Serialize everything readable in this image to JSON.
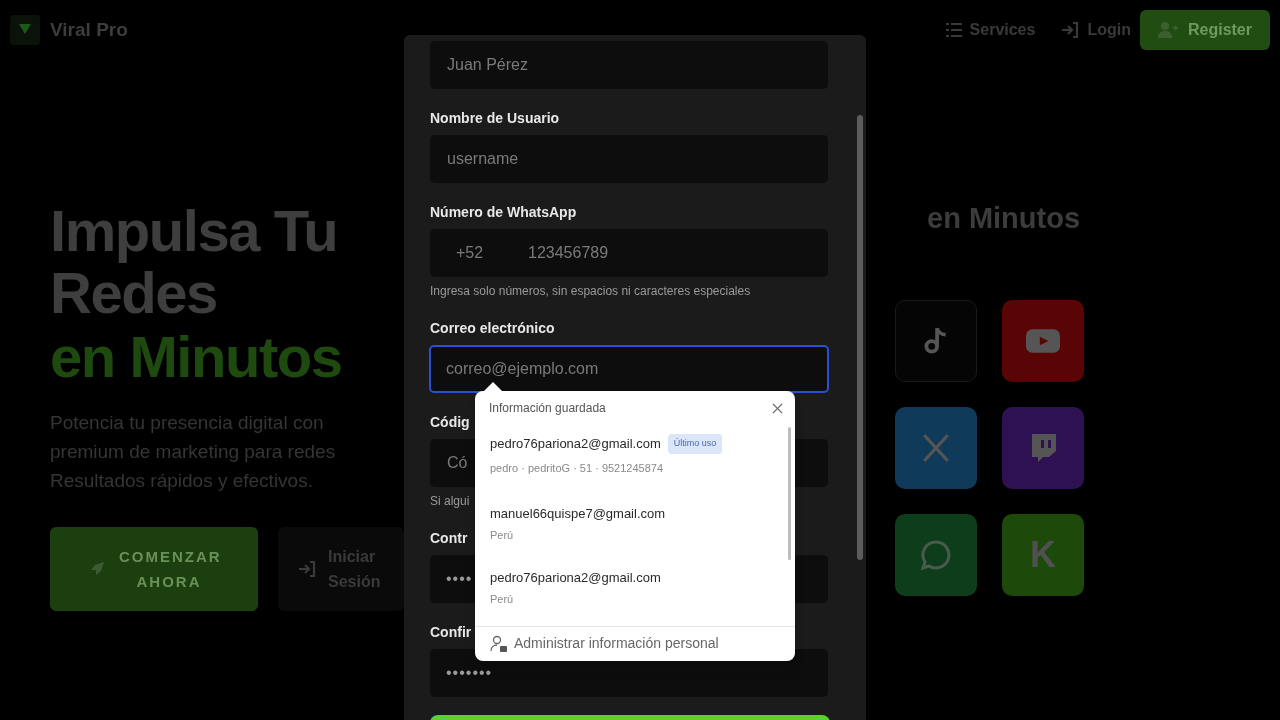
{
  "header": {
    "brand": "Viral Pro",
    "nav": [
      {
        "kind": "list",
        "label": "Services"
      },
      {
        "kind": "login",
        "label": "Login"
      }
    ],
    "register_button": "Register"
  },
  "hero": {
    "title_lines": [
      "Impulsa Tu",
      "Redes"
    ],
    "title_accent": "en Minutos",
    "description_lines": [
      "Potencia tu presencia digital con",
      "premium de marketing para redes",
      "Resultados rápidos y efectivos."
    ],
    "primary_button": "COMENZAR AHORA",
    "secondary_button": "Iniciar Sesión"
  },
  "side_heading": "en Minutos",
  "social_tiles": [
    {
      "kind": "tiktok",
      "color": "#050505"
    },
    {
      "kind": "youtube",
      "color": "#5a0505"
    },
    {
      "kind": "x",
      "color": "#0f3a5a"
    },
    {
      "kind": "twitch",
      "color": "#2d1152"
    },
    {
      "kind": "whatsapp",
      "color": "#0d3d1a"
    },
    {
      "kind": "kick",
      "color": "#1d4a0a",
      "glyph": "K"
    }
  ],
  "modal": {
    "fields": [
      {
        "kind": "text",
        "placeholder": "Juan Pérez",
        "focused": false
      },
      {
        "kind": "text",
        "label": "Nombre de Usuario",
        "placeholder": "username",
        "focused": false
      },
      {
        "kind": "phone",
        "label": "Número de WhatsApp",
        "prefix": "+52",
        "placeholder": "123456789",
        "hint": "Ingresa solo números, sin espacios ni caracteres especiales",
        "focused": false
      },
      {
        "kind": "text",
        "label": "Correo electrónico",
        "placeholder": "correo@ejemplo.com",
        "focused": true
      },
      {
        "kind": "text",
        "label": "Códig",
        "placeholder": "Có",
        "hint": "Si algui",
        "focused": false
      },
      {
        "kind": "password",
        "label": "Contr",
        "value": "••••",
        "focused": false
      },
      {
        "kind": "password",
        "label": "Confir",
        "value": "•••••••",
        "focused": false
      }
    ]
  },
  "autofill": {
    "title": "Información guardada",
    "entries": [
      {
        "email": "pedro76pariona2@gmail.com",
        "badge": "Último uso",
        "detail": "pedro · pedritoG · 51 · 9521245874"
      },
      {
        "email": "manuel66quispe7@gmail.com",
        "detail": "Perú"
      },
      {
        "email": "pedro76pariona2@gmail.com",
        "detail": "Perú"
      }
    ],
    "footer": "Administrar información personal"
  }
}
